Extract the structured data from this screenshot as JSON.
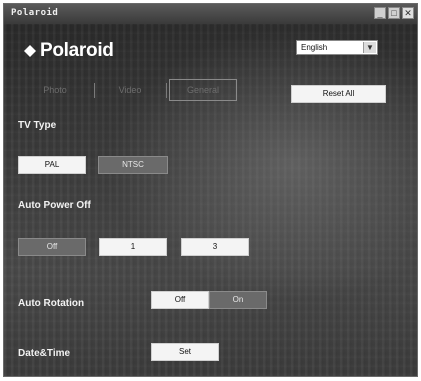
{
  "window": {
    "title": "Polaroid"
  },
  "titlebar_buttons": {
    "minimize": "_",
    "maximize": "□",
    "close": "✕"
  },
  "logo": {
    "text": "Polaroid"
  },
  "language": {
    "selected": "English"
  },
  "tabs": [
    {
      "label": "Photo"
    },
    {
      "label": "Video"
    },
    {
      "label": "General"
    }
  ],
  "reset_all_label": "Reset All",
  "tv_type": {
    "label": "TV Type",
    "options": [
      "PAL",
      "NTSC"
    ]
  },
  "auto_power_off": {
    "label": "Auto Power Off",
    "options": [
      "Off",
      "1",
      "3"
    ]
  },
  "auto_rotation": {
    "label": "Auto Rotation",
    "options": [
      "Off",
      "On"
    ]
  },
  "date_time": {
    "label": "Date&Time",
    "set_label": "Set"
  },
  "colors": {
    "background": "#3a3a3a",
    "text": "#f2f2f2",
    "button": "#f4f4f4",
    "selected_button": "#6a6a6a"
  },
  "icons": {
    "logo_mark": "diamond-icon",
    "dropdown": "chevron-down-icon"
  }
}
